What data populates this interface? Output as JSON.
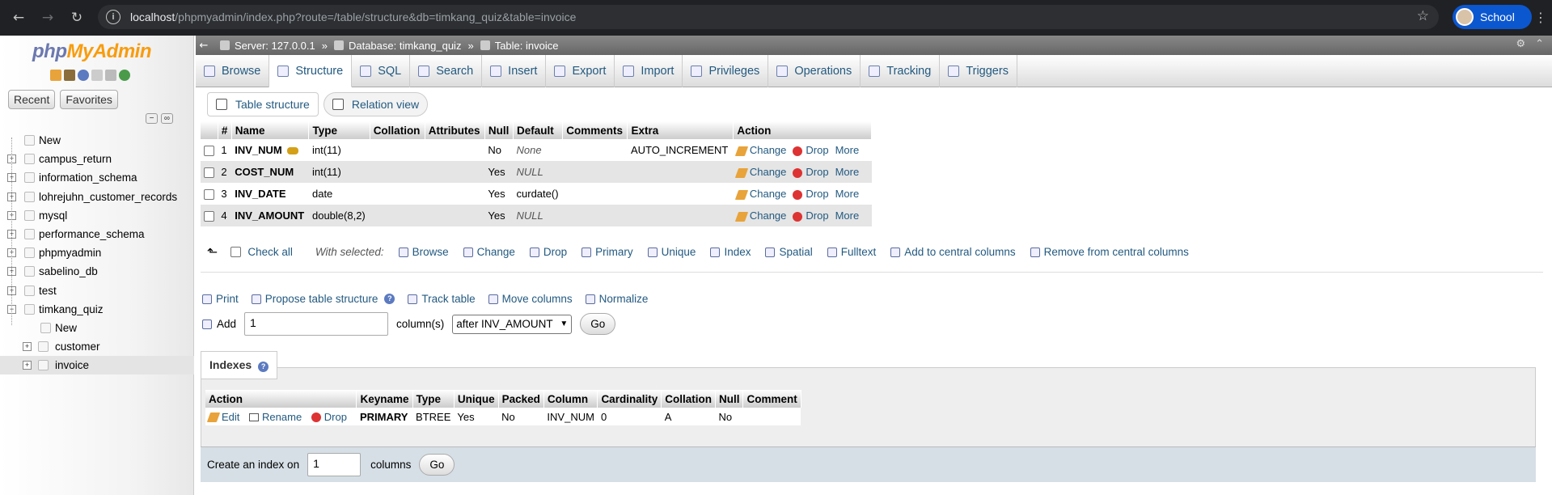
{
  "browser": {
    "url_host": "localhost",
    "url_path": "/phpmyadmin/index.php?route=/table/structure&db=timkang_quiz&table=invoice",
    "profile_label": "School"
  },
  "sidebar": {
    "logo_php": "php",
    "logo_my": "MyAdmin",
    "recent_label": "Recent",
    "favorites_label": "Favorites",
    "new_label": "New",
    "databases": [
      "campus_return",
      "information_schema",
      "lohrejuhn_customer_records",
      "mysql",
      "performance_schema",
      "phpmyadmin",
      "sabelino_db",
      "test",
      "timkang_quiz"
    ],
    "sub_new": "New",
    "tables": [
      "customer",
      "invoice"
    ]
  },
  "breadcrumb": {
    "server": "Server: 127.0.0.1",
    "database": "Database: timkang_quiz",
    "table": "Table: invoice"
  },
  "menu_tabs": [
    "Browse",
    "Structure",
    "SQL",
    "Search",
    "Insert",
    "Export",
    "Import",
    "Privileges",
    "Operations",
    "Tracking",
    "Triggers"
  ],
  "active_tab": "Structure",
  "sub_tabs": [
    "Table structure",
    "Relation view"
  ],
  "structure": {
    "headers": [
      "#",
      "Name",
      "Type",
      "Collation",
      "Attributes",
      "Null",
      "Default",
      "Comments",
      "Extra",
      "Action"
    ],
    "rows": [
      {
        "num": "1",
        "name": "INV_NUM",
        "type": "int(11)",
        "null": "No",
        "default": "None",
        "extra": "AUTO_INCREMENT",
        "primary": true
      },
      {
        "num": "2",
        "name": "COST_NUM",
        "type": "int(11)",
        "null": "Yes",
        "default": "NULL",
        "extra": ""
      },
      {
        "num": "3",
        "name": "INV_DATE",
        "type": "date",
        "null": "Yes",
        "default": "curdate()",
        "extra": ""
      },
      {
        "num": "4",
        "name": "INV_AMOUNT",
        "type": "double(8,2)",
        "null": "Yes",
        "default": "NULL",
        "extra": ""
      }
    ],
    "action_change": "Change",
    "action_drop": "Drop",
    "action_more": "More"
  },
  "with_selected": {
    "check_all": "Check all",
    "label": "With selected:",
    "items": [
      "Browse",
      "Change",
      "Drop",
      "Primary",
      "Unique",
      "Index",
      "Spatial",
      "Fulltext",
      "Add to central columns",
      "Remove from central columns"
    ]
  },
  "tools": {
    "print": "Print",
    "propose": "Propose table structure",
    "track": "Track table",
    "move": "Move columns",
    "normalize": "Normalize"
  },
  "add_columns": {
    "add_label": "Add",
    "count": "1",
    "columns_label": "column(s)",
    "position": "after INV_AMOUNT",
    "go": "Go"
  },
  "indexes": {
    "title": "Indexes",
    "headers": [
      "Action",
      "Keyname",
      "Type",
      "Unique",
      "Packed",
      "Column",
      "Cardinality",
      "Collation",
      "Null",
      "Comment"
    ],
    "row": {
      "edit": "Edit",
      "rename": "Rename",
      "drop": "Drop",
      "keyname": "PRIMARY",
      "type": "BTREE",
      "unique": "Yes",
      "packed": "No",
      "column": "INV_NUM",
      "cardinality": "0",
      "collation": "A",
      "null": "No",
      "comment": ""
    },
    "create_label": "Create an index on",
    "create_count": "1",
    "columns_label": "columns",
    "go": "Go"
  }
}
